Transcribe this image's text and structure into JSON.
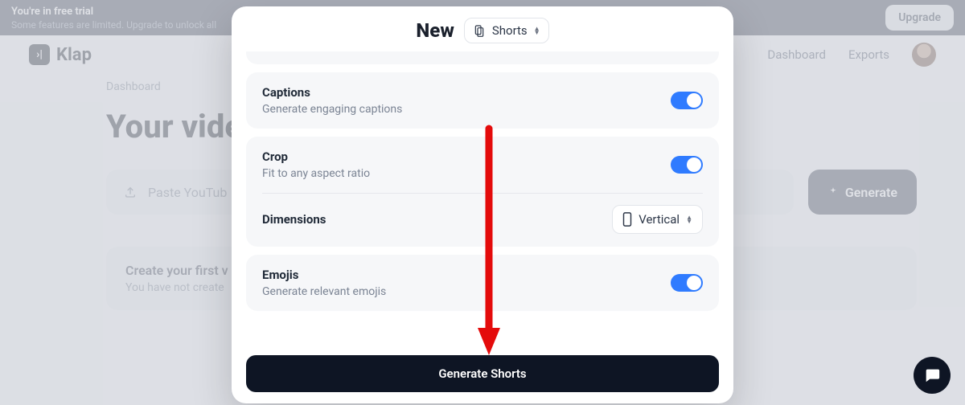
{
  "banner": {
    "line1": "You're in free trial",
    "line2": "Some features are limited. Upgrade to unlock all",
    "upgrade": "Upgrade"
  },
  "brand": "Klap",
  "nav": {
    "dashboard": "Dashboard",
    "exports": "Exports"
  },
  "page": {
    "breadcrumb": "Dashboard",
    "heading": "Your vide",
    "url_placeholder": "Paste YouTub",
    "generate": "Generate",
    "card_title": "Create your first v",
    "card_sub": "You have not create"
  },
  "modal": {
    "title": "New",
    "type": "Shorts",
    "settings": {
      "captions": {
        "title": "Captions",
        "desc": "Generate engaging captions",
        "on": true
      },
      "crop": {
        "title": "Crop",
        "desc": "Fit to any aspect ratio",
        "on": true
      },
      "dimensions": {
        "label": "Dimensions",
        "value": "Vertical"
      },
      "emojis": {
        "title": "Emojis",
        "desc": "Generate relevant emojis",
        "on": true
      }
    },
    "cta": "Generate Shorts"
  },
  "icons": {
    "logo": "klap-logo",
    "upload": "upload-icon",
    "sparkle": "sparkle-icon",
    "shorts": "shorts-icon",
    "phone": "phone-icon",
    "chat": "chat-icon"
  }
}
